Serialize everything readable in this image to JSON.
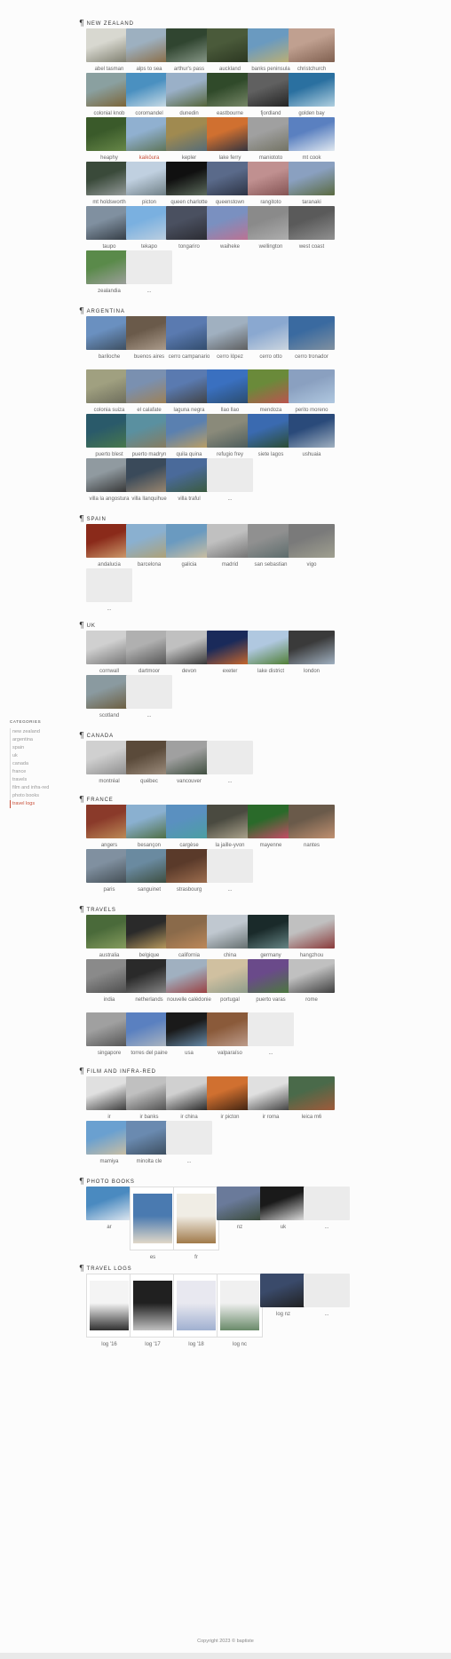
{
  "sidebar": {
    "title": "CATEGORIES",
    "items": [
      {
        "label": "new zealand",
        "active": false
      },
      {
        "label": "argentina",
        "active": false
      },
      {
        "label": "spain",
        "active": false
      },
      {
        "label": "uk",
        "active": false
      },
      {
        "label": "canada",
        "active": false
      },
      {
        "label": "france",
        "active": false
      },
      {
        "label": "travels",
        "active": false
      },
      {
        "label": "film and infra-red",
        "active": false
      },
      {
        "label": "photo books",
        "active": false
      },
      {
        "label": "travel logs",
        "active": true
      }
    ]
  },
  "colors": {
    "accent": "#c8503a",
    "placeholder": "#ebebeb"
  },
  "sections": [
    {
      "title": "NEW ZEALAND",
      "icon": "pilcrow-icon",
      "items": [
        {
          "caption": "abel tasman",
          "c1": "#d8d8d0",
          "c2": "#7a7a6a"
        },
        {
          "caption": "alps to sea",
          "c1": "#9db0c0",
          "c2": "#8a6a40"
        },
        {
          "caption": "arthur's pass",
          "c1": "#304530",
          "c2": "#8a9a8a"
        },
        {
          "caption": "auckland",
          "c1": "#4a5a3a",
          "c2": "#2a3520"
        },
        {
          "caption": "banks peninsula",
          "c1": "#6a9ac0",
          "c2": "#c0b070"
        },
        {
          "caption": "christchurch",
          "c1": "#c0a090",
          "c2": "#806050"
        },
        {
          "caption": "colonial knob",
          "c1": "#8aa0a0",
          "c2": "#7a6030"
        },
        {
          "caption": "coromandel",
          "c1": "#4a90c0",
          "c2": "#d0e0e8"
        },
        {
          "caption": "dunedin",
          "c1": "#9ab0c8",
          "c2": "#506030"
        },
        {
          "caption": "eastbourne",
          "c1": "#304a2a",
          "c2": "#7a8a6a"
        },
        {
          "caption": "fjordland",
          "c1": "#606060",
          "c2": "#202020"
        },
        {
          "caption": "golden bay",
          "c1": "#2a70a0",
          "c2": "#b0d0e0"
        },
        {
          "caption": "heaphy",
          "c1": "#3a5a2a",
          "c2": "#6a8a4a"
        },
        {
          "caption": "kaikōura",
          "c1": "#90b0d0",
          "c2": "#5a7050",
          "accent": true
        },
        {
          "caption": "kepler",
          "c1": "#a08a50",
          "c2": "#506a7a"
        },
        {
          "caption": "lake ferry",
          "c1": "#d07030",
          "c2": "#2a3040"
        },
        {
          "caption": "maniototo",
          "c1": "#a0a0a0",
          "c2": "#707060"
        },
        {
          "caption": "mt cook",
          "c1": "#5a80c0",
          "c2": "#e0e8f0"
        },
        {
          "caption": "mt holdsworth",
          "c1": "#3a4a3a",
          "c2": "#9aa0a0"
        },
        {
          "caption": "picton",
          "c1": "#c0d0e0",
          "c2": "#6a7a80"
        },
        {
          "caption": "queen charlotte",
          "c1": "#101010",
          "c2": "#607060"
        },
        {
          "caption": "queenstown",
          "c1": "#5a6a8a",
          "c2": "#2a3040"
        },
        {
          "caption": "rangitoto",
          "c1": "#c09090",
          "c2": "#805050"
        },
        {
          "caption": "taranaki",
          "c1": "#8aa0c0",
          "c2": "#5a6a40"
        },
        {
          "caption": "taupo",
          "c1": "#8090a0",
          "c2": "#303840"
        },
        {
          "caption": "tekapo",
          "c1": "#7ab0e0",
          "c2": "#c0d0e0"
        },
        {
          "caption": "tongariro",
          "c1": "#4a5060",
          "c2": "#2a2a30"
        },
        {
          "caption": "waiheke",
          "c1": "#7a90c0",
          "c2": "#c07090"
        },
        {
          "caption": "wellington",
          "c1": "#8a8a8a",
          "c2": "#b0b0b0"
        },
        {
          "caption": "west coast",
          "c1": "#5a5a5a",
          "c2": "#909090"
        },
        {
          "caption": "zealandia",
          "c1": "#5a8a4a",
          "c2": "#a0a0a0"
        },
        {
          "caption": "...",
          "placeholder": true
        }
      ]
    },
    {
      "title": "ARGENTINA",
      "icon": "pilcrow-icon",
      "items": [
        {
          "caption": "bariloche",
          "c1": "#6a90c0",
          "c2": "#3a4a5a"
        },
        {
          "caption": "buenos aires",
          "c1": "#6a5a4a",
          "c2": "#b0a090"
        },
        {
          "caption": "cerro campanario",
          "c1": "#5a7ab0",
          "c2": "#304a6a"
        },
        {
          "caption": "cerro lópez",
          "c1": "#a0b0c0",
          "c2": "#5a5a5a"
        },
        {
          "caption": "cerro otto",
          "c1": "#8aa8d0",
          "c2": "#d0d8e0"
        },
        {
          "caption": "cerro tronador",
          "c1": "#3a6aa0",
          "c2": "#8090a0"
        },
        {
          "caption": "colonia suiza",
          "c1": "#a0a080",
          "c2": "#6a6a5a"
        },
        {
          "caption": "el calafate",
          "c1": "#7a90b0",
          "c2": "#a08050"
        },
        {
          "caption": "laguna negra",
          "c1": "#5a7ab0",
          "c2": "#404040"
        },
        {
          "caption": "llao llao",
          "c1": "#3a70c0",
          "c2": "#2a4a6a"
        },
        {
          "caption": "mendoza",
          "c1": "#6a8a3a",
          "c2": "#c05050"
        },
        {
          "caption": "perito moreno",
          "c1": "#8aa0c0",
          "c2": "#b0c8e0"
        },
        {
          "caption": "puerto blest",
          "c1": "#2a5a6a",
          "c2": "#4a7a4a"
        },
        {
          "caption": "puerto madryn",
          "c1": "#5a90a0",
          "c2": "#8a7a5a"
        },
        {
          "caption": "quila quina",
          "c1": "#5a80b0",
          "c2": "#c0a060"
        },
        {
          "caption": "refugio frey",
          "c1": "#8a8a7a",
          "c2": "#4a5a5a"
        },
        {
          "caption": "siete lagos",
          "c1": "#3a6ab0",
          "c2": "#2a4a2a"
        },
        {
          "caption": "ushuaia",
          "c1": "#2a4a7a",
          "c2": "#a0b0c0"
        },
        {
          "caption": "villa la angostura",
          "c1": "#909aa0",
          "c2": "#303030"
        },
        {
          "caption": "villa llanquihue",
          "c1": "#3a4a5a",
          "c2": "#a08a70"
        },
        {
          "caption": "villa traful",
          "c1": "#4a6a9a",
          "c2": "#3a5a3a"
        },
        {
          "caption": "...",
          "placeholder": true
        }
      ]
    },
    {
      "title": "SPAIN",
      "icon": "pilcrow-icon",
      "items": [
        {
          "caption": "andalucia",
          "c1": "#8a2a1a",
          "c2": "#d0a070"
        },
        {
          "caption": "barcelona",
          "c1": "#8ab0d0",
          "c2": "#b0a070"
        },
        {
          "caption": "galicia",
          "c1": "#6a9ac0",
          "c2": "#d0c0a0"
        },
        {
          "caption": "madrid",
          "c1": "#c0c0c0",
          "c2": "#707070"
        },
        {
          "caption": "san sebastian",
          "c1": "#909090",
          "c2": "#5a6a6a"
        },
        {
          "caption": "vigo",
          "c1": "#7a7a7a",
          "c2": "#a0a090"
        },
        {
          "caption": "...",
          "placeholder": true
        }
      ]
    },
    {
      "title": "UK",
      "icon": "pilcrow-icon",
      "items": [
        {
          "caption": "cornwall",
          "c1": "#d0d0d0",
          "c2": "#707070"
        },
        {
          "caption": "dartmoor",
          "c1": "#b0b0b0",
          "c2": "#505050"
        },
        {
          "caption": "devon",
          "c1": "#c0c0c0",
          "c2": "#303030"
        },
        {
          "caption": "exeter",
          "c1": "#1a2a5a",
          "c2": "#d06a2a"
        },
        {
          "caption": "lake district",
          "c1": "#b0c8e0",
          "c2": "#4a7a2a"
        },
        {
          "caption": "london",
          "c1": "#3a3a3a",
          "c2": "#a0b0c0"
        },
        {
          "caption": "scotland",
          "c1": "#8a9aa0",
          "c2": "#6a5a3a"
        },
        {
          "caption": "...",
          "placeholder": true
        }
      ]
    },
    {
      "title": "CANADA",
      "icon": "pilcrow-icon",
      "items": [
        {
          "caption": "montréal",
          "c1": "#d0d0d0",
          "c2": "#8a8a8a"
        },
        {
          "caption": "québec",
          "c1": "#5a4a3a",
          "c2": "#a09080"
        },
        {
          "caption": "vancouver",
          "c1": "#a0a0a0",
          "c2": "#3a4a3a"
        },
        {
          "caption": "...",
          "placeholder": true
        }
      ]
    },
    {
      "title": "FRANCE",
      "icon": "pilcrow-icon",
      "items": [
        {
          "caption": "angers",
          "c1": "#8a3a2a",
          "c2": "#c0905a"
        },
        {
          "caption": "besançon",
          "c1": "#8ab0d0",
          "c2": "#4a6a3a"
        },
        {
          "caption": "cargèse",
          "c1": "#5a90c0",
          "c2": "#4aa0a0"
        },
        {
          "caption": "la jaille-yvon",
          "c1": "#4a4a40",
          "c2": "#b0a890"
        },
        {
          "caption": "mayenne",
          "c1": "#2a6a2a",
          "c2": "#d04a6a"
        },
        {
          "caption": "nantes",
          "c1": "#6a5a4a",
          "c2": "#c09070"
        },
        {
          "caption": "paris",
          "c1": "#8090a0",
          "c2": "#404a50"
        },
        {
          "caption": "sanguinet",
          "c1": "#6a8aa0",
          "c2": "#3a4a3a"
        },
        {
          "caption": "strasbourg",
          "c1": "#5a3a2a",
          "c2": "#a07050"
        },
        {
          "caption": "...",
          "placeholder": true
        }
      ]
    },
    {
      "title": "TRAVELS",
      "icon": "pilcrow-icon",
      "items": [
        {
          "caption": "australia",
          "c1": "#4a6a3a",
          "c2": "#8aa060"
        },
        {
          "caption": "belgique",
          "c1": "#2a2a2a",
          "c2": "#c0a060"
        },
        {
          "caption": "california",
          "c1": "#8a6a4a",
          "c2": "#c08a5a"
        },
        {
          "caption": "china",
          "c1": "#c0c8d0",
          "c2": "#606a6a"
        },
        {
          "caption": "germany",
          "c1": "#1a2a2a",
          "c2": "#6a8a8a"
        },
        {
          "caption": "hangzhou",
          "c1": "#c0c0c0",
          "c2": "#8a3a3a"
        },
        {
          "caption": "india",
          "c1": "#8a8a8a",
          "c2": "#4a4a4a"
        },
        {
          "caption": "netherlands",
          "c1": "#2a2a2a",
          "c2": "#8a8a8a"
        },
        {
          "caption": "nouvelle calédonie",
          "c1": "#a0b0c0",
          "c2": "#9a3a3a"
        },
        {
          "caption": "portugal",
          "c1": "#d0c0a0",
          "c2": "#8a9a8a"
        },
        {
          "caption": "puerto varas",
          "c1": "#6a4a8a",
          "c2": "#4a7a3a"
        },
        {
          "caption": "rome",
          "c1": "#c0c0c0",
          "c2": "#404040"
        },
        {
          "caption": "singapore",
          "c1": "#a0a0a0",
          "c2": "#505050"
        },
        {
          "caption": "torres del paine",
          "c1": "#5a80c0",
          "c2": "#b0b8c0"
        },
        {
          "caption": "usa",
          "c1": "#1a1a1a",
          "c2": "#6a90b0"
        },
        {
          "caption": "valparaíso",
          "c1": "#8a5a3a",
          "c2": "#c0a090"
        },
        {
          "caption": "...",
          "placeholder": true
        }
      ]
    },
    {
      "title": "FILM AND INFRA-RED",
      "icon": "pilcrow-icon",
      "items": [
        {
          "caption": "ir",
          "c1": "#e0e0e0",
          "c2": "#303030"
        },
        {
          "caption": "ir banks",
          "c1": "#c0c0c0",
          "c2": "#4a4a4a"
        },
        {
          "caption": "ir china",
          "c1": "#d0d0d0",
          "c2": "#202020"
        },
        {
          "caption": "ir picton",
          "c1": "#d07030",
          "c2": "#3a2010"
        },
        {
          "caption": "ir roma",
          "c1": "#e0e0e0",
          "c2": "#3a3a3a"
        },
        {
          "caption": "leica m6",
          "c1": "#4a6a4a",
          "c2": "#a05a3a"
        },
        {
          "caption": "mamiya",
          "c1": "#6aa0d0",
          "c2": "#d0c0a0"
        },
        {
          "caption": "minolta cle",
          "c1": "#6a8ab0",
          "c2": "#3a4a5a"
        },
        {
          "caption": "...",
          "placeholder": true
        }
      ]
    },
    {
      "title": "PHOTO BOOKS",
      "icon": "pilcrow-icon",
      "items": [
        {
          "caption": "ar",
          "c1": "#4a8ac0",
          "c2": "#e0e8f0"
        },
        {
          "caption": "es",
          "c1": "#4a7ab0",
          "c2": "#e0d8c8",
          "book": true
        },
        {
          "caption": "fr",
          "c1": "#f0ede5",
          "c2": "#a07a4a",
          "book": true
        },
        {
          "caption": "nz",
          "c1": "#6a7a9a",
          "c2": "#3a4a3a"
        },
        {
          "caption": "uk",
          "c1": "#1a1a1a",
          "c2": "#e0e0e0"
        },
        {
          "caption": "...",
          "placeholder": true
        }
      ]
    },
    {
      "title": "TRAVEL LOGS",
      "icon": "pilcrow-icon",
      "items": [
        {
          "caption": "log '16",
          "c1": "#f4f4f4",
          "c2": "#303030",
          "book": true
        },
        {
          "caption": "log '17",
          "c1": "#202020",
          "c2": "#c0c0c0",
          "book": true
        },
        {
          "caption": "log '18",
          "c1": "#e8e8f0",
          "c2": "#a0b0d0",
          "book": true
        },
        {
          "caption": "log nc",
          "c1": "#f0f0f0",
          "c2": "#6a8a6a",
          "book": true
        },
        {
          "caption": "log nz",
          "c1": "#3a4a6a",
          "c2": "#202020"
        },
        {
          "caption": "...",
          "placeholder": true
        }
      ]
    }
  ],
  "footer": {
    "copyright": "Copyright 2023 © baptiste"
  }
}
